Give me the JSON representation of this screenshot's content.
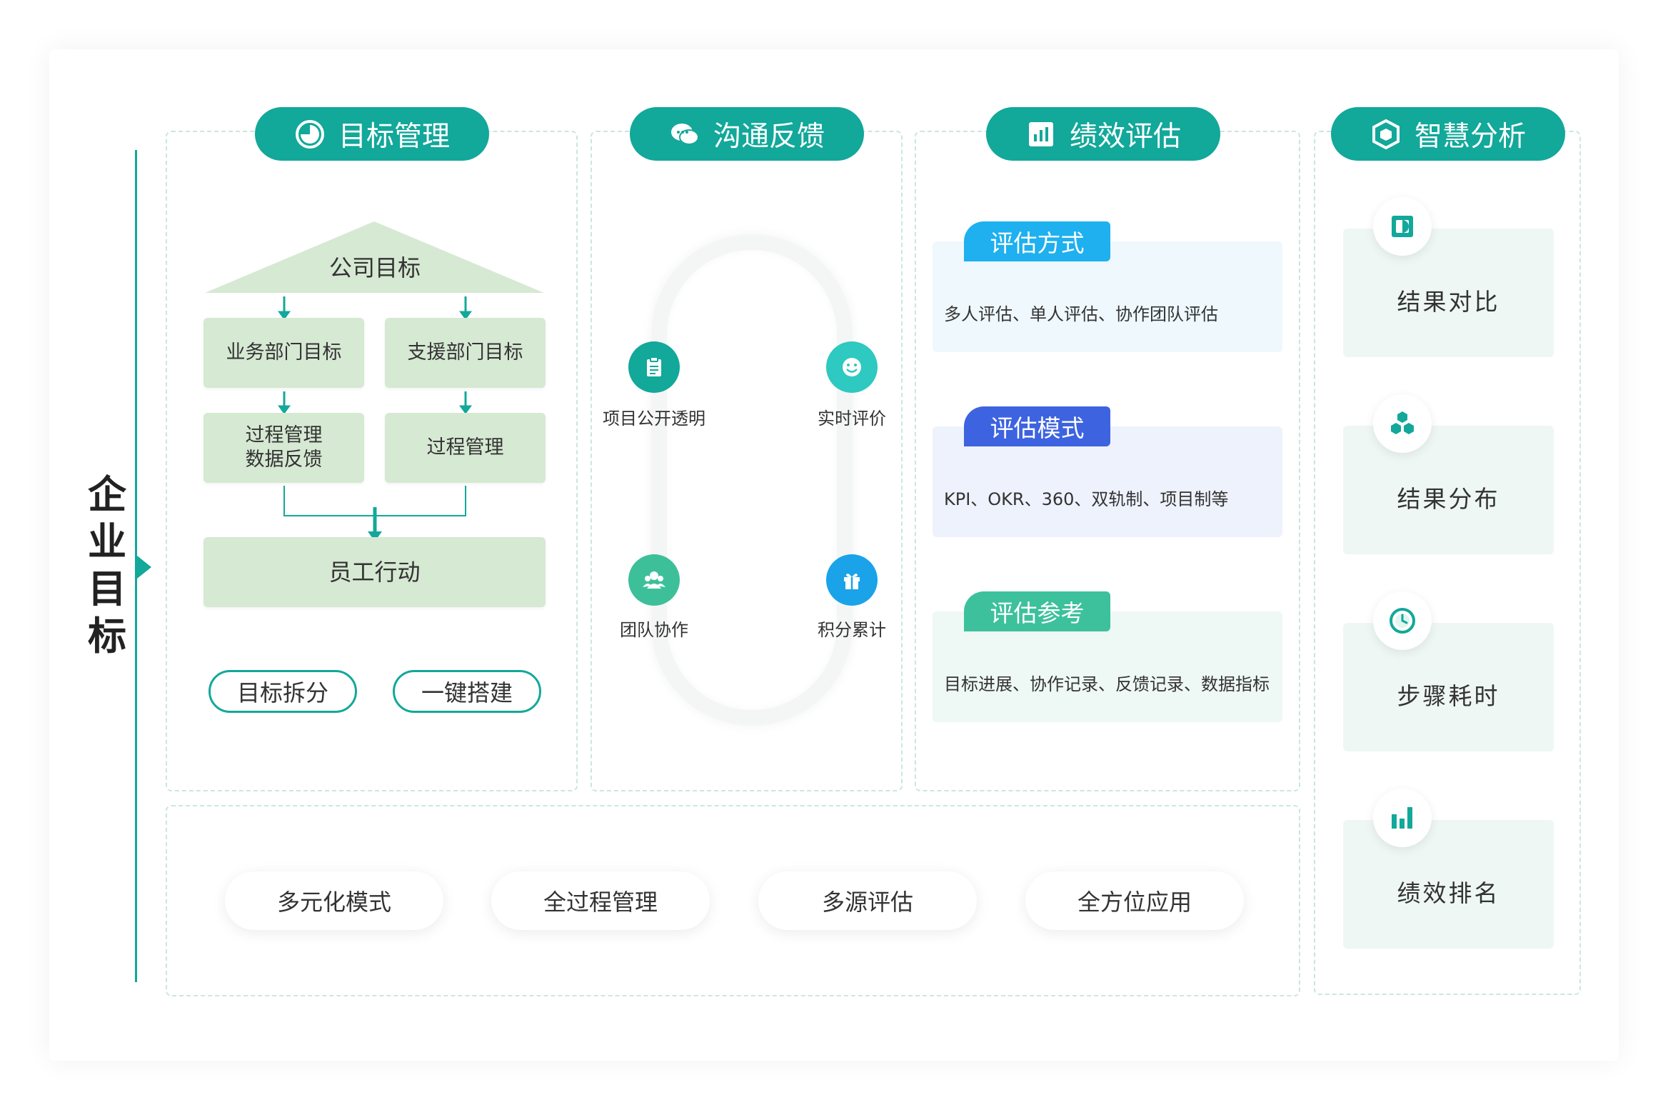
{
  "side_title": [
    "企",
    "业",
    "目",
    "标"
  ],
  "columns": {
    "goal": {
      "header": "目标管理",
      "company_goal": "公司目标",
      "business_dept": "业务部门目标",
      "support_dept": "支援部门目标",
      "process_left_line1": "过程管理",
      "process_left_line2": "数据反馈",
      "process_right": "过程管理",
      "employee_action": "员工行动",
      "btn_split": "目标拆分",
      "btn_build": "一键搭建"
    },
    "comm": {
      "header": "沟通反馈",
      "items": [
        {
          "label": "项目公开透明",
          "icon": "clipboard-icon",
          "color": "#12a89a"
        },
        {
          "label": "实时评价",
          "icon": "smile-icon",
          "color": "#2ec9c0"
        },
        {
          "label": "团队协作",
          "icon": "team-icon",
          "color": "#3dbf9a"
        },
        {
          "label": "积分累计",
          "icon": "gift-icon",
          "color": "#1aa3e8"
        }
      ]
    },
    "perf": {
      "header": "绩效评估",
      "blocks": [
        {
          "tag": "评估方式",
          "text": "多人评估、单人评估、协作团队评估",
          "tag_color": "#1eb0ef",
          "bg": "#eef8fd"
        },
        {
          "tag": "评估模式",
          "text": "KPI、OKR、360、双轨制、项目制等",
          "tag_color": "#3d63e0",
          "bg": "#eef2fc"
        },
        {
          "tag": "评估参考",
          "text": "目标进展、协作记录、反馈记录、数据指标",
          "tag_color": "#3cc19c",
          "bg": "#eef8f4"
        }
      ]
    },
    "analysis": {
      "header": "智慧分析",
      "items": [
        {
          "label": "结果对比",
          "icon": "compare-icon"
        },
        {
          "label": "结果分布",
          "icon": "hexagons-icon"
        },
        {
          "label": "步骤耗时",
          "icon": "clock-icon"
        },
        {
          "label": "绩效排名",
          "icon": "bar-chart-icon"
        }
      ]
    }
  },
  "features": [
    "多元化模式",
    "全过程管理",
    "多源评估",
    "全方位应用"
  ],
  "colors": {
    "primary": "#12a89a",
    "green_box": "#d6e9d3",
    "dash": "#c9e7de"
  }
}
